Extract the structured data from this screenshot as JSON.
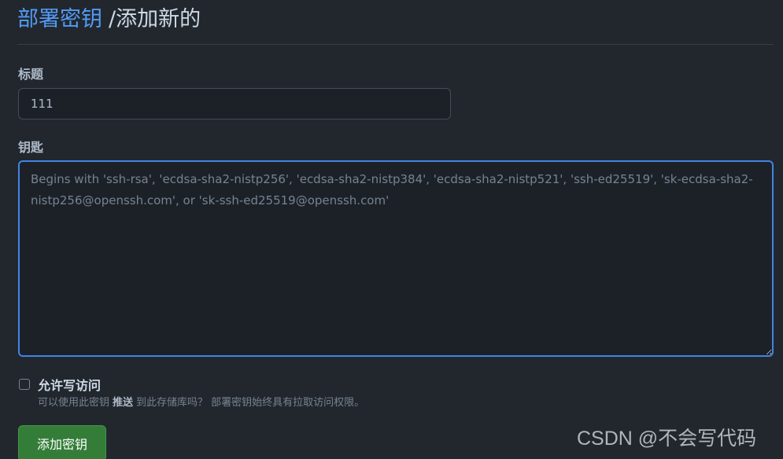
{
  "header": {
    "breadcrumb_link": "部署密钥",
    "current_page": "/添加新的"
  },
  "form": {
    "title_label": "标题",
    "title_value": "111",
    "key_label": "钥匙",
    "key_placeholder": "Begins with 'ssh-rsa', 'ecdsa-sha2-nistp256', 'ecdsa-sha2-nistp384', 'ecdsa-sha2-nistp521', 'ssh-ed25519', 'sk-ecdsa-sha2-nistp256@openssh.com', or 'sk-ssh-ed25519@openssh.com'",
    "allow_write_label": "允许写访问",
    "allow_write_checked": false,
    "help_before": "可以使用此密钥",
    "help_strong": "推送",
    "help_after": "到此存储库吗？ 部署密钥始终具有拉取访问权限。",
    "submit_label": "添加密钥"
  },
  "watermark": "CSDN @不会写代码",
  "colors": {
    "background": "#22272e",
    "link": "#539bf5",
    "focus_border": "#4184e4",
    "primary_button": "#347d39"
  }
}
